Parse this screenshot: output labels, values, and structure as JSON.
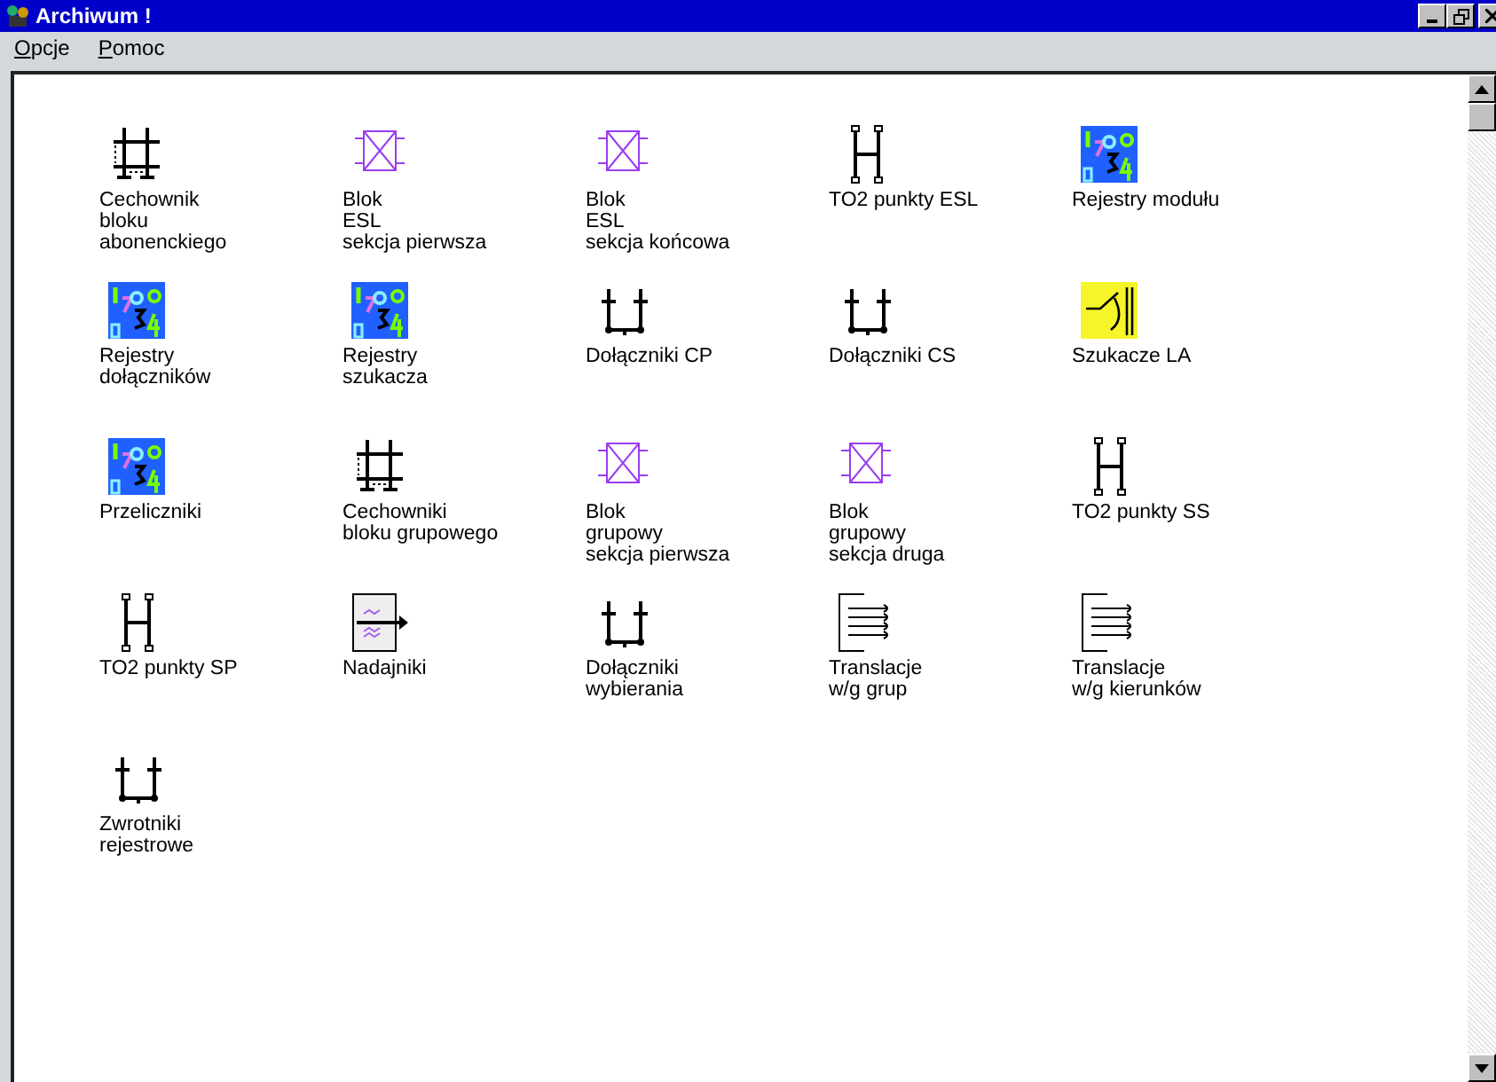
{
  "window": {
    "title": "Archiwum !"
  },
  "menu": [
    {
      "label": "Opcje"
    },
    {
      "label": "Pomoc"
    }
  ],
  "items": [
    {
      "kind": "calibrator",
      "label": [
        "Cechownik",
        "bloku",
        "abonenckiego"
      ]
    },
    {
      "kind": "block",
      "label": [
        "Blok",
        "ESL",
        "sekcja pierwsza"
      ]
    },
    {
      "kind": "block",
      "label": [
        "Blok",
        "ESL",
        "sekcja końcowa"
      ]
    },
    {
      "kind": "hframe",
      "label": [
        "TO2 punkty ESL"
      ]
    },
    {
      "kind": "registers",
      "label": [
        "Rejestry modułu"
      ]
    },
    {
      "kind": "registers",
      "label": [
        "Rejestry",
        "dołączników"
      ]
    },
    {
      "kind": "registers",
      "label": [
        "Rejestry",
        "szukacza"
      ]
    },
    {
      "kind": "junctor",
      "label": [
        "Dołączniki CP"
      ]
    },
    {
      "kind": "junctor",
      "label": [
        "Dołączniki CS"
      ]
    },
    {
      "kind": "selector",
      "label": [
        "Szukacze LA"
      ]
    },
    {
      "kind": "registers",
      "label": [
        "Przeliczniki"
      ]
    },
    {
      "kind": "calibrator",
      "label": [
        "Cechowniki",
        "bloku grupowego"
      ]
    },
    {
      "kind": "block",
      "label": [
        "Blok",
        "grupowy",
        "sekcja pierwsza"
      ]
    },
    {
      "kind": "block",
      "label": [
        "Blok",
        "grupowy",
        "sekcja druga"
      ]
    },
    {
      "kind": "hframe",
      "label": [
        "TO2 punkty SS"
      ]
    },
    {
      "kind": "hframe",
      "label": [
        "TO2 punkty SP"
      ]
    },
    {
      "kind": "transmitter",
      "label": [
        "Nadajniki"
      ]
    },
    {
      "kind": "junctor",
      "label": [
        "Dołączniki",
        "wybierania"
      ]
    },
    {
      "kind": "translation",
      "label": [
        "Translacje",
        "w/g grup"
      ]
    },
    {
      "kind": "translation",
      "label": [
        "Translacje",
        "w/g kierunków"
      ]
    },
    {
      "kind": "junctor",
      "label": [
        "Zwrotniki",
        "rejestrowe"
      ]
    }
  ]
}
